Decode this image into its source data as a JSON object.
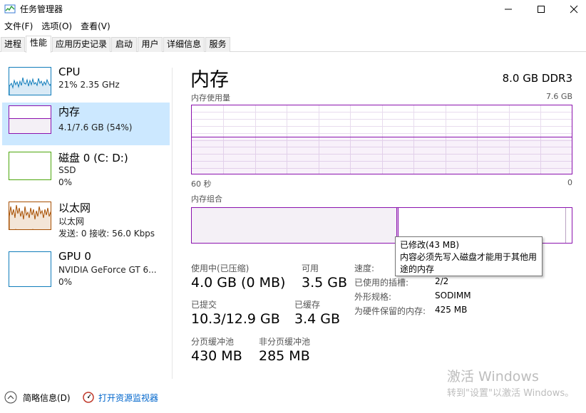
{
  "window": {
    "title": "任务管理器",
    "minimize_icon": "minimize-icon",
    "maximize_icon": "maximize-icon",
    "close_icon": "close-icon"
  },
  "menu": {
    "items": [
      "文件(F)",
      "选项(O)",
      "查看(V)"
    ]
  },
  "tabs": {
    "items": [
      "进程",
      "性能",
      "应用历史记录",
      "启动",
      "用户",
      "详细信息",
      "服务"
    ],
    "active": "性能"
  },
  "sidebar": {
    "items": [
      {
        "name": "CPU",
        "line1": "21%  2.35 GHz",
        "line2": "",
        "color": "#117dbb"
      },
      {
        "name": "内存",
        "line1": "4.1/7.6 GB (54%)",
        "line2": "",
        "color": "#8b12ae",
        "fill_fraction": 0.54
      },
      {
        "name": "磁盘 0 (C: D:)",
        "line1": "SSD",
        "line2": "0%",
        "color": "#4da60c"
      },
      {
        "name": "以太网",
        "line1": "以太网",
        "line2": "发送: 0 接收: 56.0 Kbps",
        "color": "#a74f01"
      },
      {
        "name": "GPU 0",
        "line1": "NVIDIA GeForce GT 6...",
        "line2": "0%",
        "color": "#117dbb"
      }
    ]
  },
  "main": {
    "title": "内存",
    "spec": "8.0 GB DDR3",
    "usage_graph": {
      "label": "内存使用量",
      "max_label": "7.6 GB",
      "time_left": "60 秒",
      "time_right": "0",
      "used_fraction": 0.54
    },
    "composition": {
      "label": "内存组合",
      "in_use_fraction": 0.54,
      "modified_fraction": 0.005,
      "standby_fraction": 0.44
    },
    "stats": {
      "in_use_label": "使用中(已压缩)",
      "in_use_value": "4.0 GB (0 MB)",
      "available_label": "可用",
      "available_value": "3.5 GB",
      "committed_label": "已提交",
      "committed_value": "10.3/12.9 GB",
      "cached_label": "已缓存",
      "cached_value": "3.4 GB",
      "paged_pool_label": "分页缓冲池",
      "paged_pool_value": "430 MB",
      "nonpaged_pool_label": "非分页缓冲池",
      "nonpaged_pool_value": "285 MB"
    },
    "details": {
      "speed_label": "速度:",
      "slots_label": "已使用的插槽:",
      "slots_value": "2/2",
      "form_label": "外形规格:",
      "form_value": "SODIMM",
      "reserved_label": "为硬件保留的内存:",
      "reserved_value": "425 MB"
    },
    "tooltip": {
      "title": "已修改(43 MB)",
      "line1": "内容必须先写入磁盘才能用于其他用",
      "line2": "途的内存"
    }
  },
  "bottom": {
    "summary_label": "简略信息(D)",
    "monitor_label": "打开资源监视器"
  },
  "watermark": {
    "line1": "激活 Windows",
    "line2": "转到\"设置\"以激活 Windows。"
  },
  "colors": {
    "memory_accent": "#8b12ae",
    "memory_fill": "#f4f0f6",
    "selected_bg": "#cce8ff"
  }
}
